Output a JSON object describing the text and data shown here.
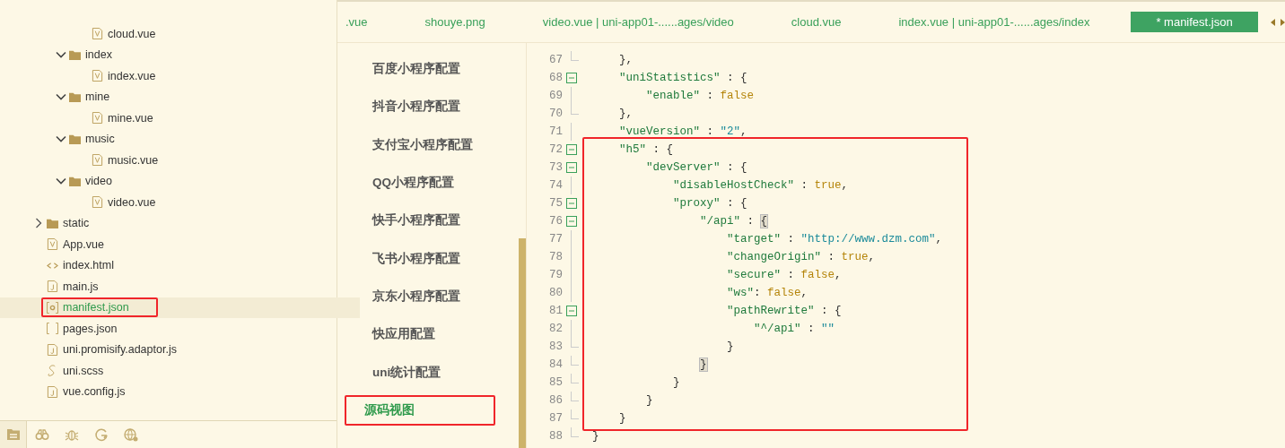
{
  "file_tree": [
    {
      "children": [
        {
          "children": [
            {
              "label": "cloud.vue",
              "kind": "vue",
              "selected": false,
              "annotated": false
            }
          ]
        },
        {
          "label": "index",
          "kind": "folder",
          "expanded": true,
          "selected": false,
          "annotated": false,
          "children": [
            {
              "label": "index.vue",
              "kind": "vue",
              "selected": false,
              "annotated": false
            }
          ]
        },
        {
          "label": "mine",
          "kind": "folder",
          "expanded": true,
          "selected": false,
          "annotated": false,
          "children": [
            {
              "label": "mine.vue",
              "kind": "vue",
              "selected": false,
              "annotated": false
            }
          ]
        },
        {
          "label": "music",
          "kind": "folder",
          "expanded": true,
          "selected": false,
          "annotated": false,
          "children": [
            {
              "label": "music.vue",
              "kind": "vue",
              "selected": false,
              "annotated": false
            }
          ]
        },
        {
          "label": "video",
          "kind": "folder",
          "expanded": true,
          "selected": false,
          "annotated": false,
          "children": [
            {
              "label": "video.vue",
              "kind": "vue",
              "selected": false,
              "annotated": false
            }
          ]
        }
      ]
    },
    {
      "label": "static",
      "kind": "folder",
      "expanded": false,
      "selected": false,
      "annotated": false
    },
    {
      "label": "App.vue",
      "kind": "vue",
      "selected": false,
      "annotated": false
    },
    {
      "label": "index.html",
      "kind": "html",
      "selected": false,
      "annotated": false
    },
    {
      "label": "main.js",
      "kind": "js",
      "selected": false,
      "annotated": false
    },
    {
      "label": "manifest.json",
      "kind": "settings",
      "selected": true,
      "annotated": true
    },
    {
      "label": "pages.json",
      "kind": "brackets",
      "selected": false,
      "annotated": false
    },
    {
      "label": "uni.promisify.adaptor.js",
      "kind": "js",
      "selected": false,
      "annotated": false
    },
    {
      "label": "uni.scss",
      "kind": "scss",
      "selected": false,
      "annotated": false
    },
    {
      "label": "vue.config.js",
      "kind": "js",
      "selected": false,
      "annotated": false
    }
  ],
  "bottom_tabs": [
    {
      "kind": "files",
      "selected": true
    },
    {
      "kind": "binoculars",
      "selected": false
    },
    {
      "kind": "bug",
      "selected": false
    },
    {
      "kind": "refresh",
      "selected": false
    },
    {
      "kind": "globe",
      "selected": false
    }
  ],
  "editor_tabs": [
    {
      "label": ".vue",
      "selected": false
    },
    {
      "label": "shouye.png",
      "selected": false
    },
    {
      "label": "video.vue | uni-app01-......ages/video",
      "selected": false
    },
    {
      "label": "cloud.vue",
      "selected": false
    },
    {
      "label": "index.vue | uni-app01-......ages/index",
      "selected": false
    },
    {
      "label": "* manifest.json",
      "selected": true
    }
  ],
  "config_nav": [
    {
      "label": "百度小程序配置",
      "selected": false,
      "annotated": false
    },
    {
      "label": "抖音小程序配置",
      "selected": false,
      "annotated": false
    },
    {
      "label": "支付宝小程序配置",
      "selected": false,
      "annotated": false
    },
    {
      "label": "QQ小程序配置",
      "selected": false,
      "annotated": false
    },
    {
      "label": "快手小程序配置",
      "selected": false,
      "annotated": false
    },
    {
      "label": "飞书小程序配置",
      "selected": false,
      "annotated": false
    },
    {
      "label": "京东小程序配置",
      "selected": false,
      "annotated": false
    },
    {
      "label": "快应用配置",
      "selected": false,
      "annotated": false
    },
    {
      "label": "uni统计配置",
      "selected": false,
      "annotated": false
    },
    {
      "label": "源码视图",
      "selected": true,
      "annotated": true
    }
  ],
  "code": {
    "blocks": [
      {
        "boxed": false,
        "lines": [
          {
            "number": "67",
            "foldable": false,
            "block_end": true,
            "tokens": [
              {
                "kind": "punct",
                "text": "    },"
              }
            ]
          },
          {
            "number": "68",
            "foldable": true,
            "tokens": [
              {
                "kind": "key",
                "text": "    \"uniStatistics\""
              },
              {
                "kind": "punct",
                "text": " : {"
              }
            ]
          },
          {
            "number": "69",
            "foldable": false,
            "block_end": false,
            "tokens": [
              {
                "kind": "key",
                "text": "        \"enable\""
              },
              {
                "kind": "punct",
                "text": " : "
              },
              {
                "kind": "bool",
                "text": "false"
              }
            ]
          },
          {
            "number": "70",
            "foldable": false,
            "block_end": true,
            "tokens": [
              {
                "kind": "punct",
                "text": "    },"
              }
            ]
          },
          {
            "number": "71",
            "foldable": false,
            "block_end": false,
            "tokens": [
              {
                "kind": "key",
                "text": "    \"vueVersion\""
              },
              {
                "kind": "punct",
                "text": " : "
              },
              {
                "kind": "string",
                "text": "\"2\""
              },
              {
                "kind": "punct",
                "text": ","
              }
            ]
          }
        ]
      },
      {
        "boxed": true,
        "lines": [
          {
            "number": "72",
            "foldable": true,
            "tokens": [
              {
                "kind": "key",
                "text": "    \"h5\""
              },
              {
                "kind": "punct",
                "text": " : {"
              }
            ]
          },
          {
            "number": "73",
            "foldable": true,
            "tokens": [
              {
                "kind": "key",
                "text": "        \"devServer\""
              },
              {
                "kind": "punct",
                "text": " : {"
              }
            ]
          },
          {
            "number": "74",
            "foldable": false,
            "block_end": false,
            "tokens": [
              {
                "kind": "key",
                "text": "            \"disableHostCheck\""
              },
              {
                "kind": "punct",
                "text": " : "
              },
              {
                "kind": "bool",
                "text": "true"
              },
              {
                "kind": "punct",
                "text": ","
              }
            ]
          },
          {
            "number": "75",
            "foldable": true,
            "tokens": [
              {
                "kind": "key",
                "text": "            \"proxy\""
              },
              {
                "kind": "punct",
                "text": " : {"
              }
            ]
          },
          {
            "number": "76",
            "foldable": true,
            "tokens": [
              {
                "kind": "key",
                "text": "                \"/api\""
              },
              {
                "kind": "punct",
                "text": " : "
              },
              {
                "kind": "punct",
                "text": "{",
                "matched": true
              }
            ]
          },
          {
            "number": "77",
            "foldable": false,
            "block_end": false,
            "tokens": [
              {
                "kind": "key",
                "text": "                    \"target\""
              },
              {
                "kind": "punct",
                "text": " : "
              },
              {
                "kind": "string",
                "text": "\"http://www.dzm.com\""
              },
              {
                "kind": "punct",
                "text": ","
              }
            ]
          },
          {
            "number": "78",
            "foldable": false,
            "block_end": false,
            "tokens": [
              {
                "kind": "key",
                "text": "                    \"changeOrigin\""
              },
              {
                "kind": "punct",
                "text": " : "
              },
              {
                "kind": "bool",
                "text": "true"
              },
              {
                "kind": "punct",
                "text": ","
              }
            ]
          },
          {
            "number": "79",
            "foldable": false,
            "block_end": false,
            "tokens": [
              {
                "kind": "key",
                "text": "                    \"secure\""
              },
              {
                "kind": "punct",
                "text": " : "
              },
              {
                "kind": "bool",
                "text": "false"
              },
              {
                "kind": "punct",
                "text": ","
              }
            ]
          },
          {
            "number": "80",
            "foldable": false,
            "block_end": false,
            "tokens": [
              {
                "kind": "key",
                "text": "                    \"ws\""
              },
              {
                "kind": "punct",
                "text": ": "
              },
              {
                "kind": "bool",
                "text": "false"
              },
              {
                "kind": "punct",
                "text": ","
              }
            ]
          },
          {
            "number": "81",
            "foldable": true,
            "tokens": [
              {
                "kind": "key",
                "text": "                    \"pathRewrite\""
              },
              {
                "kind": "punct",
                "text": " : {"
              }
            ]
          },
          {
            "number": "82",
            "foldable": false,
            "block_end": false,
            "tokens": [
              {
                "kind": "key",
                "text": "                        \"^/api\""
              },
              {
                "kind": "punct",
                "text": " : "
              },
              {
                "kind": "string",
                "text": "\"\""
              }
            ]
          },
          {
            "number": "83",
            "foldable": false,
            "block_end": true,
            "tokens": [
              {
                "kind": "punct",
                "text": "                    }"
              }
            ]
          },
          {
            "number": "84",
            "foldable": false,
            "block_end": true,
            "tokens": [
              {
                "kind": "punct",
                "text": "                }",
                "matched": true
              }
            ]
          },
          {
            "number": "85",
            "foldable": false,
            "block_end": true,
            "tokens": [
              {
                "kind": "punct",
                "text": "            }"
              }
            ]
          },
          {
            "number": "86",
            "foldable": false,
            "block_end": true,
            "tokens": [
              {
                "kind": "punct",
                "text": "        }"
              }
            ]
          },
          {
            "number": "87",
            "foldable": false,
            "block_end": true,
            "tokens": [
              {
                "kind": "punct",
                "text": "    }"
              }
            ]
          }
        ]
      },
      {
        "boxed": false,
        "lines": [
          {
            "number": "88",
            "foldable": false,
            "block_end": true,
            "tokens": [
              {
                "kind": "punct",
                "text": "}"
              }
            ]
          }
        ]
      }
    ]
  }
}
